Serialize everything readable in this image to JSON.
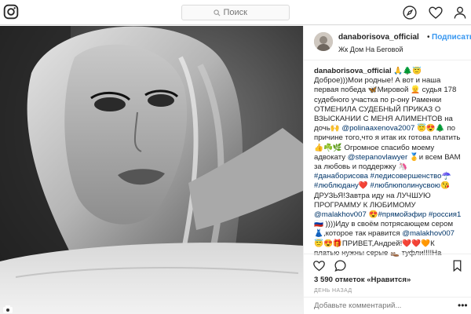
{
  "search": {
    "placeholder": "Поиск"
  },
  "post": {
    "username": "danaborisova_official",
    "follow_separator": "•",
    "follow_label": "Подписаться",
    "location": "Жк Дом На Беговой",
    "caption_lines": [
      [
        {
          "t": "u",
          "v": "danaborisova_official"
        },
        {
          "t": "x",
          "v": " 🙏🌲😇"
        }
      ],
      [
        {
          "t": "x",
          "v": "Доброе)))Мои родные! А вот и наша"
        }
      ],
      [
        {
          "t": "x",
          "v": "первая победа 🦋Мировой 👱 судья 178"
        }
      ],
      [
        {
          "t": "x",
          "v": "судебного участка по р-ону Раменки"
        }
      ],
      [
        {
          "t": "x",
          "v": "ОТМЕНИЛА СУДЕБНЫЙ ПРИКАЗ О"
        }
      ],
      [
        {
          "t": "x",
          "v": "ВЗЫСКАНИИ С МЕНЯ АЛИМЕНТОВ на"
        }
      ],
      [
        {
          "t": "x",
          "v": "дочь🙌 "
        },
        {
          "t": "l",
          "v": "@polinaaxenova2007"
        },
        {
          "t": "x",
          "v": " 😇😍🌲 по"
        }
      ],
      [
        {
          "t": "x",
          "v": "причине того,что я итак их готова платить"
        }
      ],
      [
        {
          "t": "x",
          "v": "👍☘️🌿 Огромное спасибо моему"
        }
      ],
      [
        {
          "t": "x",
          "v": "адвокату "
        },
        {
          "t": "l",
          "v": "@stepanovlawyer"
        },
        {
          "t": "x",
          "v": " 🥇и всем ВАМ"
        }
      ],
      [
        {
          "t": "x",
          "v": "за любовь и поддержку 🦄"
        }
      ],
      [
        {
          "t": "l",
          "v": "#данаборисова"
        },
        {
          "t": "x",
          "v": " "
        },
        {
          "t": "l",
          "v": "#ледисовершенство"
        },
        {
          "t": "x",
          "v": "☂️"
        }
      ],
      [
        {
          "t": "l",
          "v": "#люблюдану"
        },
        {
          "t": "x",
          "v": "❤️ "
        },
        {
          "t": "l",
          "v": "#люблюполинусвою"
        },
        {
          "t": "x",
          "v": "😘"
        }
      ],
      [
        {
          "t": "x",
          "v": "ДРУЗЬЯ!Завтра иду на ЛУЧШУЮ"
        }
      ],
      [
        {
          "t": "x",
          "v": "ПРОГРАММУ К ЛЮБИМОМУ"
        }
      ],
      [
        {
          "t": "l",
          "v": "@malakhov007"
        },
        {
          "t": "x",
          "v": " 😍"
        },
        {
          "t": "l",
          "v": "#прямойэфир"
        },
        {
          "t": "x",
          "v": " "
        },
        {
          "t": "l",
          "v": "#россия1"
        }
      ],
      [
        {
          "t": "x",
          "v": "🇷🇺 ))))Иду в своём потрясающем сером"
        }
      ],
      [
        {
          "t": "x",
          "v": "👗,которое так нравится "
        },
        {
          "t": "l",
          "v": "@malakhov007"
        }
      ],
      [
        {
          "t": "x",
          "v": "😇😍🎁ПРИВЕТ,Андрей!❤️❤️🧡К"
        }
      ],
      [
        {
          "t": "x",
          "v": "платью нужны серые 👞 туфли!!!!На"
        }
      ]
    ],
    "likes_count": "3 590",
    "likes_label": "отметок «Нравится»",
    "time_ago": "ДЕНЬ НАЗАД",
    "comment_placeholder": "Добавьте комментарий...",
    "more_label": "•••"
  },
  "icons": {
    "logo": "instagram-logo-icon",
    "explore": "compass-icon",
    "activity": "heart-icon",
    "profile": "person-icon",
    "like": "heart-outline-icon",
    "comment": "speech-bubble-icon",
    "save": "bookmark-icon"
  },
  "colors": {
    "link": "#003569",
    "follow": "#3897f0",
    "border": "#dbdbdb",
    "muted": "#999999"
  }
}
